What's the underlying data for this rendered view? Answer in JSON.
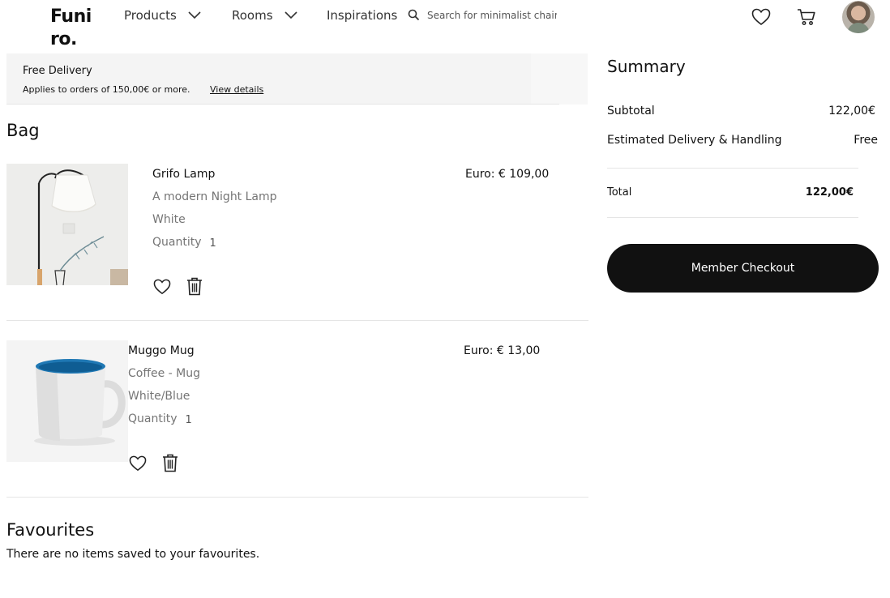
{
  "header": {
    "logo": "Funi ro.",
    "nav": [
      {
        "label": "Products",
        "has_dropdown": true
      },
      {
        "label": "Rooms",
        "has_dropdown": true
      },
      {
        "label": "Inspirations",
        "has_dropdown": false
      }
    ],
    "search": {
      "placeholder": "Search for minimalist chair",
      "value": ""
    },
    "icons": [
      "heart-icon",
      "cart-icon",
      "avatar"
    ]
  },
  "banner": {
    "title": "Free Delivery",
    "subtitle": "Applies to orders of 150,00€ or more.",
    "link": "View details"
  },
  "bag": {
    "title": "Bag",
    "items": [
      {
        "name": "Grifo Lamp",
        "description": "A modern Night Lamp",
        "color": "White",
        "quantity_label": "Quantity",
        "quantity": "1",
        "price": "Euro: € 109,00",
        "image": "floor-lamp-image"
      },
      {
        "name": "Muggo Mug",
        "description": "Coffee - Mug",
        "color": "White/Blue",
        "quantity_label": "Quantity",
        "quantity": "1",
        "price": "Euro: € 13,00",
        "image": "mug-image"
      }
    ]
  },
  "favourites": {
    "title": "Favourites",
    "empty_text": "There are no items saved to your favourites."
  },
  "summary": {
    "title": "Summary",
    "subtotal_label": "Subtotal",
    "subtotal_value": "122,00€",
    "delivery_label": "Estimated Delivery & Handling",
    "delivery_value": "Free",
    "total_label": "Total",
    "total_value": "122,00€",
    "checkout_label": "Member Checkout"
  },
  "colors": {
    "text": "#111111",
    "muted": "#757575",
    "banner_bg": "#f4f4f4",
    "button_bg": "#111111",
    "divider": "#e5e5e5"
  }
}
